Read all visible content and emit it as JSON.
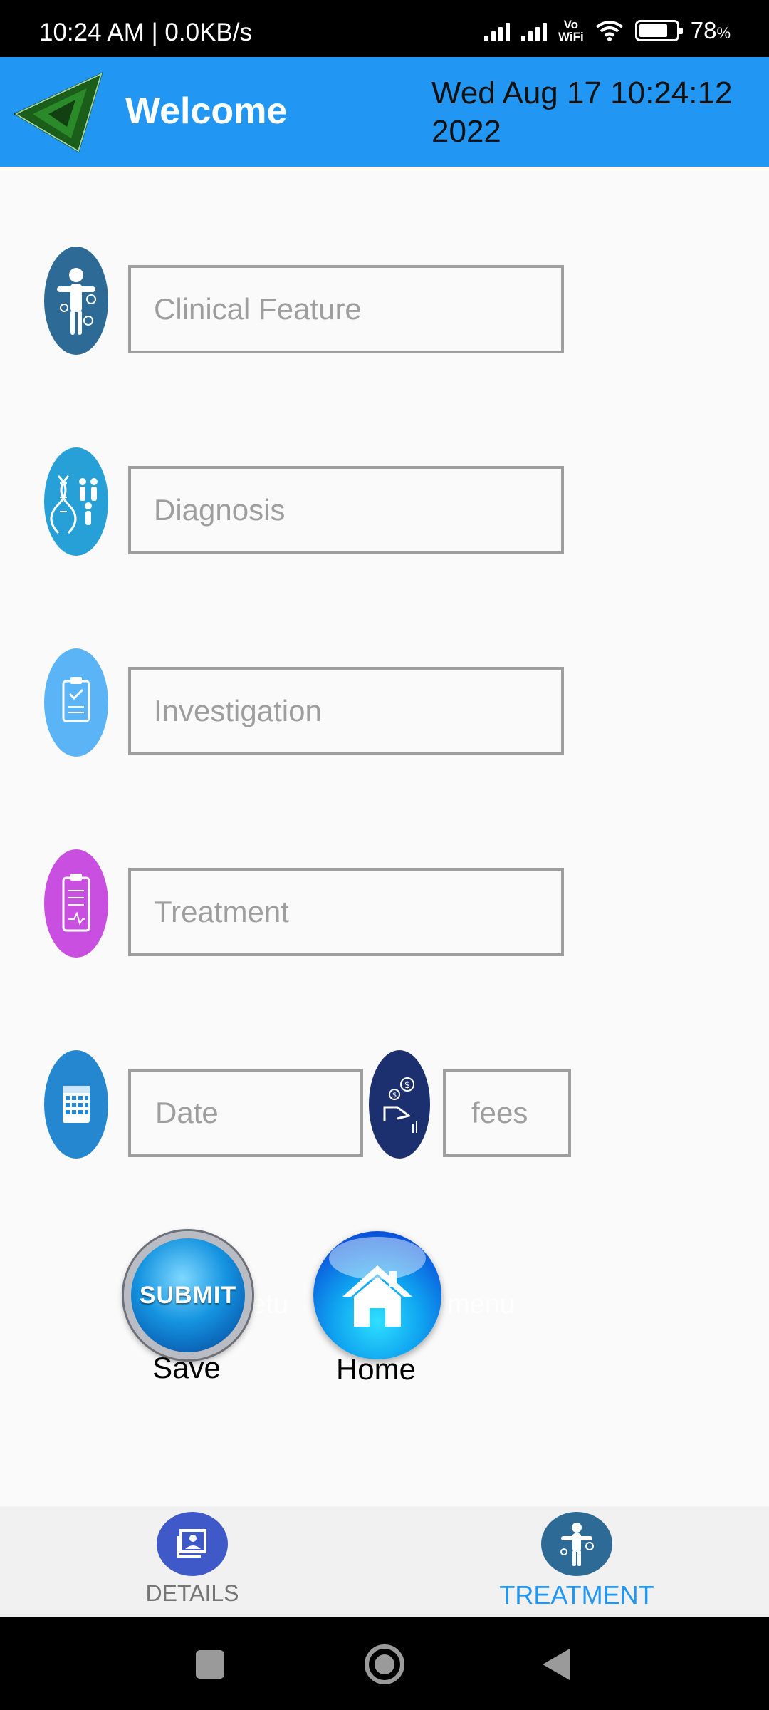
{
  "status_bar": {
    "time": "10:24 AM | 0.0KB/s",
    "vowifi_top": "Vo",
    "vowifi_bottom": "WiFi",
    "battery": "78",
    "battery_unit": "%"
  },
  "app_bar": {
    "title": "Welcome",
    "datetime": "Wed Aug 17 10:24:12 2022",
    "accent_color": "#2196f3"
  },
  "form": {
    "clinical_feature_placeholder": "Clinical Feature",
    "diagnosis_placeholder": "Diagnosis",
    "investigation_placeholder": "Investigation",
    "treatment_placeholder": "Treatment",
    "date_placeholder": "Date",
    "fees_placeholder": "fees"
  },
  "buttons": {
    "submit_label": "SUBMIT",
    "save_caption": "Save",
    "home_caption": "Home",
    "ghost_left": "etu",
    "ghost_right": "menu"
  },
  "bottom_nav": {
    "details_label": "DETAILS",
    "treatment_label": "TREATMENT",
    "active": "treatment"
  }
}
